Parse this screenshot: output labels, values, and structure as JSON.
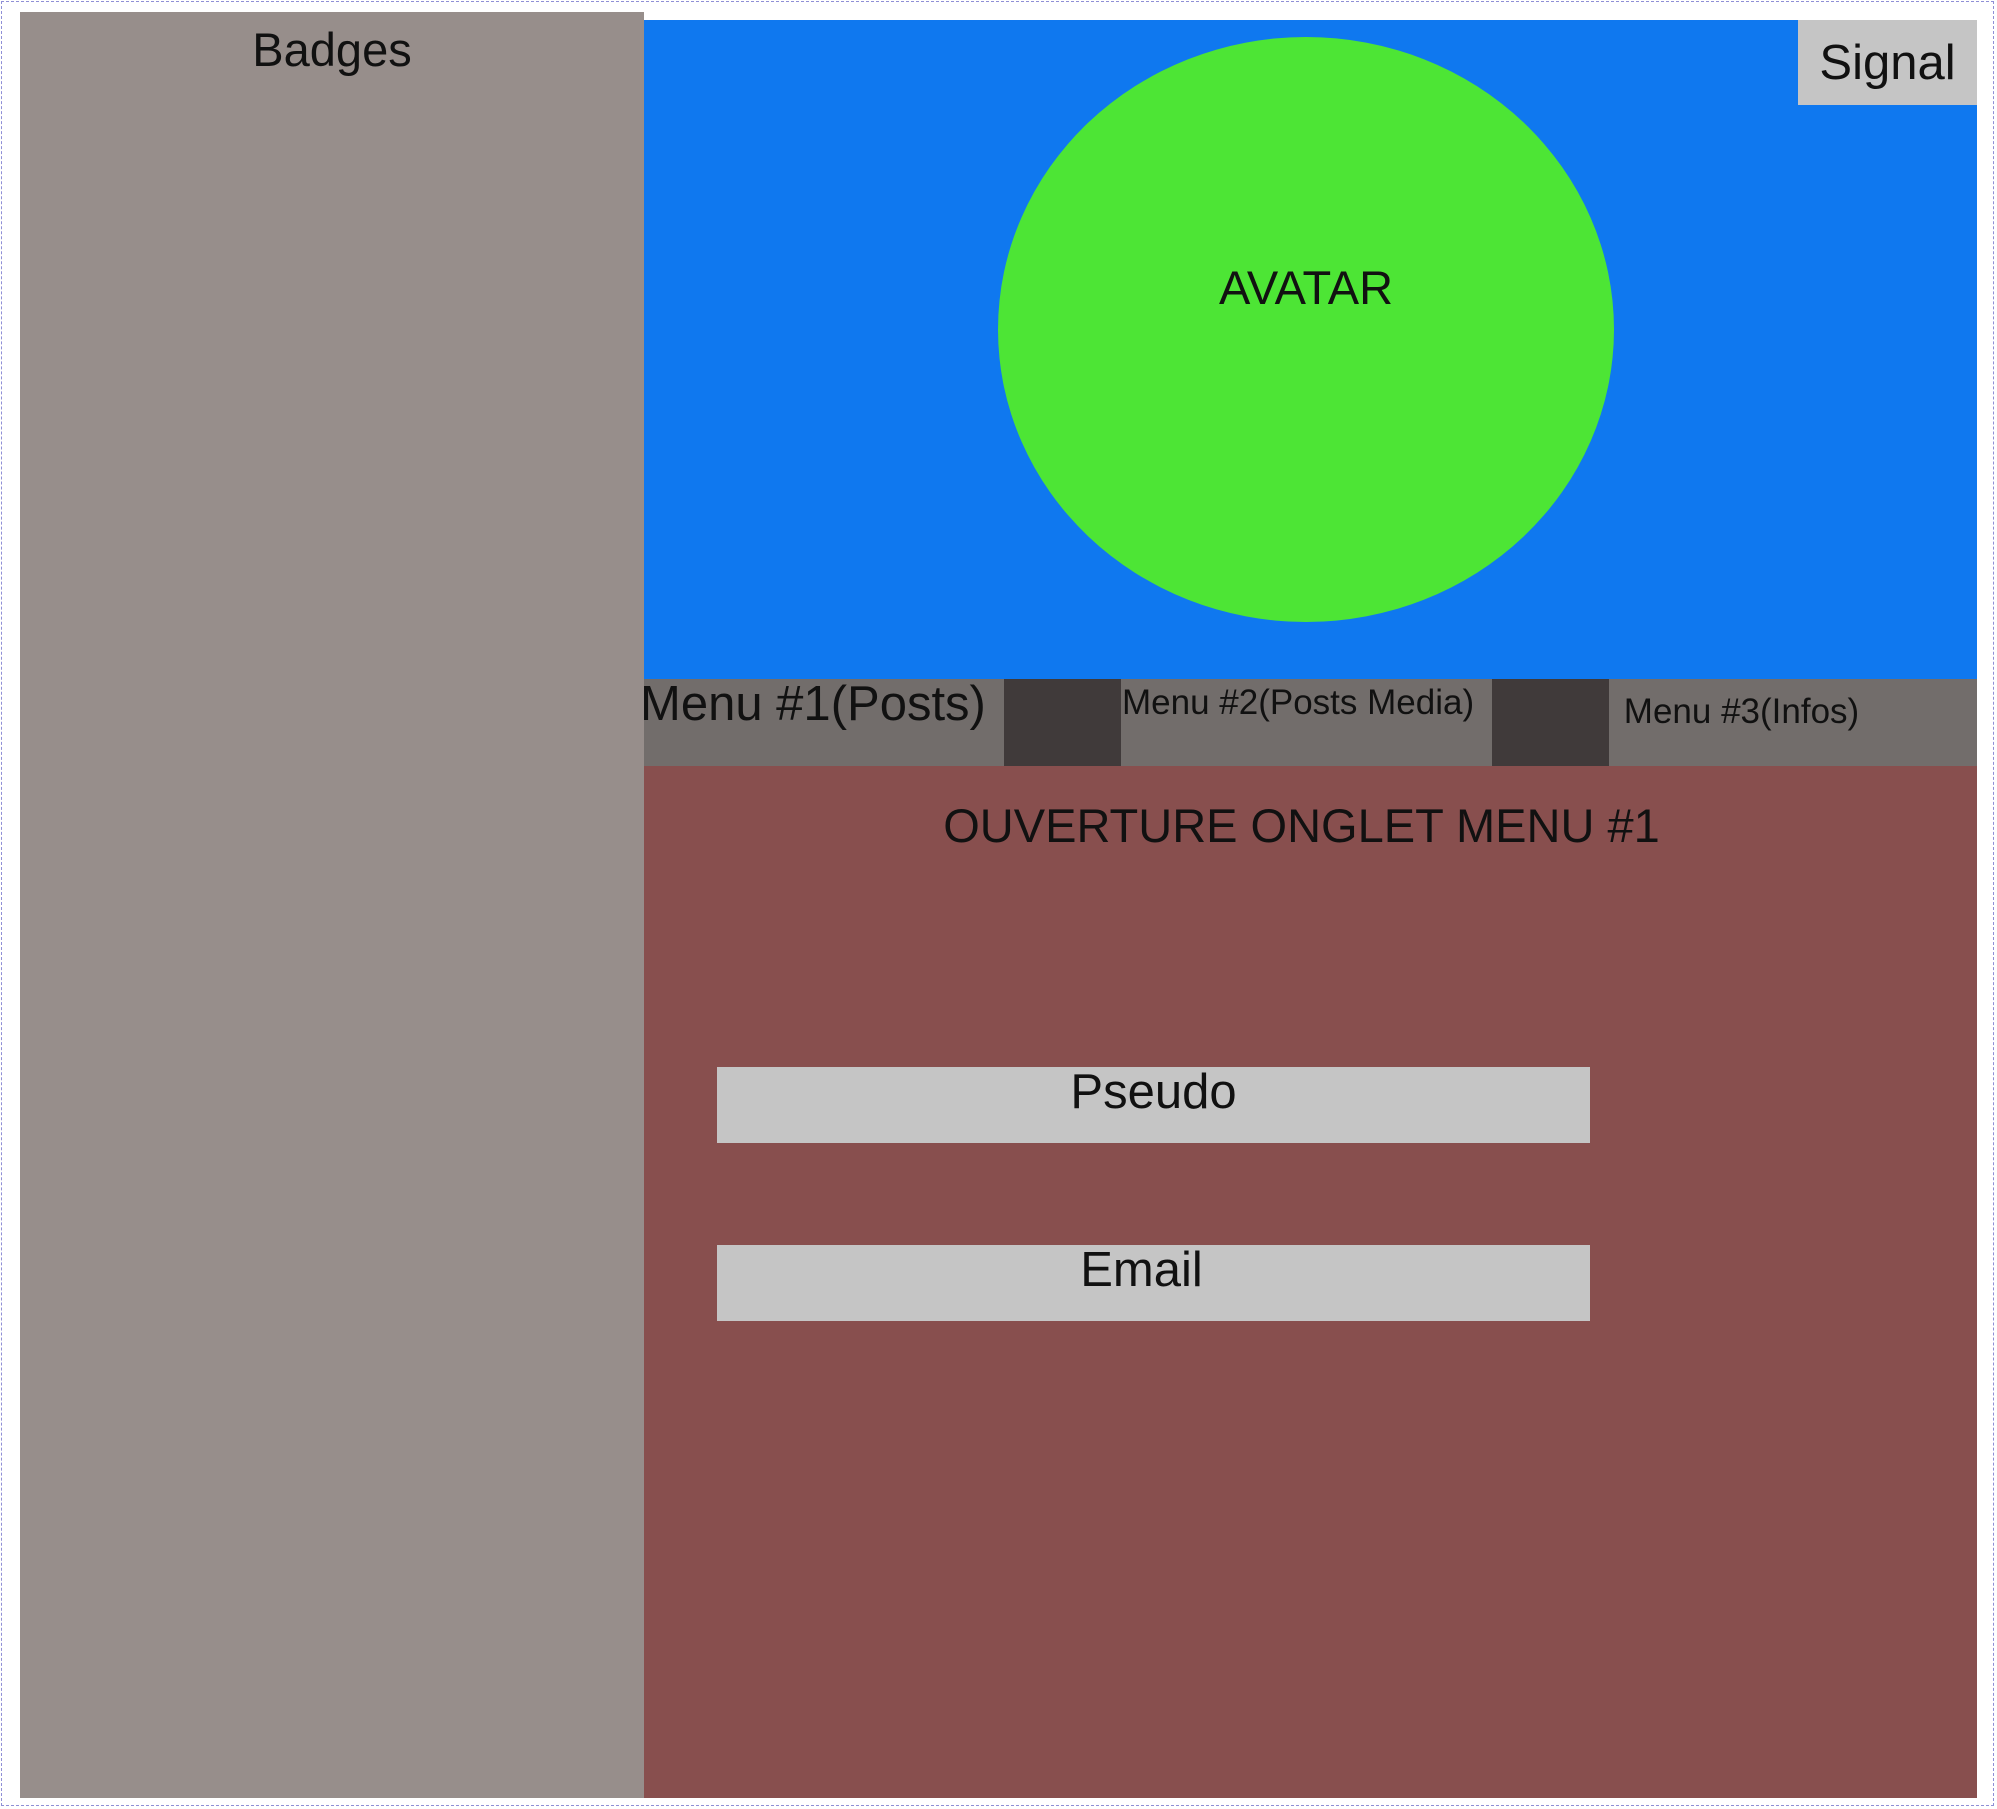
{
  "sidebar": {
    "title": "Badges"
  },
  "header": {
    "avatar_label": "AVATAR",
    "signal_label": "Signal"
  },
  "menu": {
    "items": [
      {
        "label": "Menu #1(Posts)"
      },
      {
        "label": "Menu #2(Posts Media)"
      },
      {
        "label": "Menu #3(Infos)"
      }
    ]
  },
  "content": {
    "title": "OUVERTURE ONGLET MENU #1",
    "pseudo_label": "Pseudo",
    "email_label": "Email"
  },
  "colors": {
    "sidebar": "#978e8b",
    "hero": "#0f78ef",
    "avatar": "#4de535",
    "menubar": "#726d6b",
    "menu_separator": "#403a3a",
    "content": "#884f4e",
    "field": "#c5c5c5"
  }
}
